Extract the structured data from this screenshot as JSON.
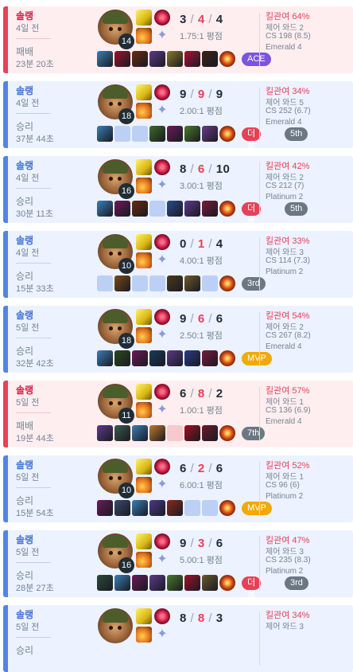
{
  "colors": {
    "win_accent": "#5383e8",
    "loss_accent": "#e84057",
    "win_bg": "#ecf2ff",
    "loss_bg": "#ffeef0",
    "mvp": "#f2a900",
    "ace": "#7a55de"
  },
  "matches": [
    {
      "outcome": "loss",
      "queue": "솔랭",
      "ago": "4일 전",
      "result": "패배",
      "duration": "23분 20초",
      "level": "14",
      "kills": "3",
      "deaths": "4",
      "assists": "4",
      "ratio": "1.75:1 평점",
      "items": [
        "#3a7fb6",
        "#a0132a",
        "#6b2a12",
        "#5d3a8a",
        "#8a7a2a",
        "#b01035",
        "#3a2414"
      ],
      "badges": [
        {
          "type": "ace",
          "label": "ACE"
        }
      ],
      "kp": "킬관여 64%",
      "wards": "제어 와드 2",
      "cs": "CS 198 (8.5)",
      "tier": "Emerald 4"
    },
    {
      "outcome": "win",
      "queue": "솔랭",
      "ago": "4일 전",
      "result": "승리",
      "duration": "37분 44초",
      "level": "18",
      "kills": "9",
      "deaths": "9",
      "assists": "9",
      "ratio": "2.00:1 평점",
      "items": [
        "#3a7fb6",
        "",
        "",
        "#3d6b2a",
        "#6b1a5a",
        "#4a7a2a",
        "#6a3a8a"
      ],
      "badges": [
        {
          "type": "multi",
          "label": "더블킬"
        },
        {
          "type": "rank",
          "label": "5th"
        }
      ],
      "kp": "킬관여 34%",
      "wards": "제어 와드 5",
      "cs": "CS 252 (6.7)",
      "tier": "Emerald 4"
    },
    {
      "outcome": "win",
      "queue": "솔랭",
      "ago": "4일 전",
      "result": "승리",
      "duration": "30분 11초",
      "level": "16",
      "kills": "8",
      "deaths": "6",
      "assists": "10",
      "ratio": "3.00:1 평점",
      "items": [
        "#3a7fb6",
        "#6b1a5a",
        "#6b2a12",
        "",
        "#2a4a8a",
        "#5d3a8a",
        "#7a1a3a"
      ],
      "badges": [
        {
          "type": "multi",
          "label": "더블킬"
        },
        {
          "type": "rank",
          "label": "5th"
        }
      ],
      "kp": "킬관여 42%",
      "wards": "제어 와드 2",
      "cs": "CS 212 (7)",
      "tier": "Platinum 2"
    },
    {
      "outcome": "win",
      "queue": "솔랭",
      "ago": "4일 전",
      "result": "승리",
      "duration": "15분 33초",
      "level": "10",
      "kills": "0",
      "deaths": "1",
      "assists": "4",
      "ratio": "4.00:1 평점",
      "items": [
        "",
        "#7a4a1a",
        "",
        "",
        "#4a3a1a",
        "#6b5a2a",
        ""
      ],
      "badges": [
        {
          "type": "rank",
          "label": "3rd"
        }
      ],
      "kp": "킬관여 33%",
      "wards": "제어 와드 3",
      "cs": "CS 114 (7.3)",
      "tier": "Platinum 2"
    },
    {
      "outcome": "win",
      "queue": "솔랭",
      "ago": "5일 전",
      "result": "승리",
      "duration": "32분 42초",
      "level": "18",
      "kills": "9",
      "deaths": "6",
      "assists": "6",
      "ratio": "2.50:1 평점",
      "items": [
        "#3a7fb6",
        "#2a4a1a",
        "#6b1a5a",
        "#1a3a5a",
        "#5d3a8a",
        "#2a3a8a",
        "#7a1a3a"
      ],
      "badges": [
        {
          "type": "mvp",
          "label": "MVP"
        }
      ],
      "kp": "킬관여 54%",
      "wards": "제어 와드 2",
      "cs": "CS 267 (8.2)",
      "tier": "Emerald 4"
    },
    {
      "outcome": "loss",
      "queue": "솔랭",
      "ago": "5일 전",
      "result": "패배",
      "duration": "19분 44초",
      "level": "11",
      "kills": "6",
      "deaths": "8",
      "assists": "2",
      "ratio": "1.00:1 평점",
      "items": [
        "#5d3a8a",
        "#3a5a4a",
        "#3a7fb6",
        "#c07a2a",
        "",
        "#a01020",
        "#6b1a2a"
      ],
      "badges": [
        {
          "type": "rank",
          "label": "7th"
        }
      ],
      "kp": "킬관여 57%",
      "wards": "제어 와드 1",
      "cs": "CS 136 (6.9)",
      "tier": "Emerald 4"
    },
    {
      "outcome": "win",
      "queue": "솔랭",
      "ago": "5일 전",
      "result": "승리",
      "duration": "15분 54초",
      "level": "10",
      "kills": "6",
      "deaths": "2",
      "assists": "6",
      "ratio": "6.00:1 평점",
      "items": [
        "#6b1a5a",
        "#3a4a6a",
        "#3a7fb6",
        "#4a3a8a",
        "#8a2a1a",
        "",
        ""
      ],
      "badges": [
        {
          "type": "mvp",
          "label": "MVP"
        }
      ],
      "kp": "킬관여 52%",
      "wards": "제어 와드 1",
      "cs": "CS 96 (6)",
      "tier": "Platinum 2"
    },
    {
      "outcome": "win",
      "queue": "솔랭",
      "ago": "5일 전",
      "result": "승리",
      "duration": "28분 27초",
      "level": "16",
      "kills": "9",
      "deaths": "3",
      "assists": "6",
      "ratio": "5.00:1 평점",
      "items": [
        "#2a4a3a",
        "#3a7fb6",
        "#6b1a5a",
        "#5d3a8a",
        "#4a7a2a",
        "#a0132a",
        "#6b5a2a"
      ],
      "badges": [
        {
          "type": "multi",
          "label": "더블킬"
        },
        {
          "type": "rank",
          "label": "3rd"
        }
      ],
      "kp": "킬관여 47%",
      "wards": "제어 와드 3",
      "cs": "CS 235 (8.3)",
      "tier": "Platinum 2"
    },
    {
      "outcome": "win",
      "queue": "솔랭",
      "ago": "5일 전",
      "result": "승리",
      "duration": "",
      "level": "",
      "kills": "8",
      "deaths": "8",
      "assists": "3",
      "ratio": "",
      "items": [],
      "badges": [],
      "kp": "킬관여 34%",
      "wards": "제어 와드 3",
      "cs": "",
      "tier": ""
    }
  ]
}
